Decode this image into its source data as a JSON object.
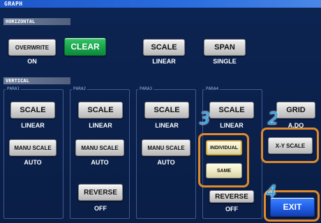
{
  "window": {
    "title": "GRAPH"
  },
  "horizontal": {
    "section_label": "HORIZONTAL",
    "overwrite_label": "OVERWRITE",
    "overwrite_value": "ON",
    "clear_label": "CLEAR",
    "scale_label": "SCALE",
    "scale_value": "LINEAR",
    "span_label": "SPAN",
    "span_value": "SINGLE"
  },
  "vertical": {
    "section_label": "VERTICAL",
    "params": [
      {
        "name": "PARA1",
        "scale_label": "SCALE",
        "scale_value": "LINEAR",
        "manu_label": "MANU SCALE",
        "manu_value": "AUTO"
      },
      {
        "name": "PARA2",
        "scale_label": "SCALE",
        "scale_value": "LINEAR",
        "manu_label": "MANU SCALE",
        "manu_value": "AUTO",
        "reverse_label": "REVERSE",
        "reverse_value": "OFF"
      },
      {
        "name": "PARA3",
        "scale_label": "SCALE",
        "scale_value": "LINEAR",
        "manu_label": "MANU SCALE",
        "manu_value": "AUTO"
      },
      {
        "name": "PARA4",
        "scale_label": "SCALE",
        "scale_value": "LINEAR",
        "reverse_label": "REVERSE",
        "reverse_value": "OFF"
      }
    ],
    "popup": {
      "individual_label": "INDIVIDUAL",
      "same_label": "SAME"
    },
    "grid_label": "GRID",
    "grid_value": "A.DO",
    "xy_scale_label": "X-Y SCALE"
  },
  "exit_label": "EXIT",
  "callouts": {
    "c2": "2",
    "c3": "3",
    "c4": "4"
  },
  "colors": {
    "callout_border": "#e08a2c",
    "callout_number": "#2aa3e6",
    "clear_button": "#18a34b",
    "exit_button": "#1f5ee6"
  }
}
